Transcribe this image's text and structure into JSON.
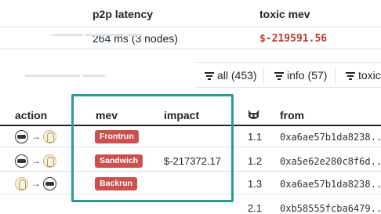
{
  "stats": {
    "p2p_label": "p2p latency",
    "toxic_label": "toxic mev",
    "p2p_value": "264 ms (3 nodes)",
    "toxic_value": "$-219591.56"
  },
  "filters": [
    {
      "label": "all (453)"
    },
    {
      "label": "info (57)"
    },
    {
      "label": "toxic"
    }
  ],
  "columns": {
    "action": "action",
    "mev": "mev",
    "impact": "impact",
    "from": "from"
  },
  "rows": [
    {
      "from_icon": "mev-bot-icon",
      "to_icon": "uniswap-icon",
      "mev": "Frontrun",
      "impact": "",
      "index": "1.1",
      "from": "0xa6ae57b1da8238..."
    },
    {
      "from_icon": "mev-bot-icon",
      "to_icon": "uniswap-icon",
      "mev": "Sandwich",
      "impact": "$-217372.17",
      "index": "1.2",
      "from": "0xa5e62e280c8f6d..."
    },
    {
      "from_icon": "uniswap-icon",
      "to_icon": "mev-bot-icon",
      "mev": "Backrun",
      "impact": "",
      "index": "1.3",
      "from": "0xa6ae57b1da8238..."
    },
    {
      "from_icon": "",
      "to_icon": "",
      "mev": "",
      "impact": "",
      "index": "2.1",
      "from": "0xb58555fcba6479..."
    }
  ],
  "colors": {
    "badge": "#c9514f",
    "toxic_value": "#c0392b",
    "highlight_border": "#2a9d8f"
  }
}
